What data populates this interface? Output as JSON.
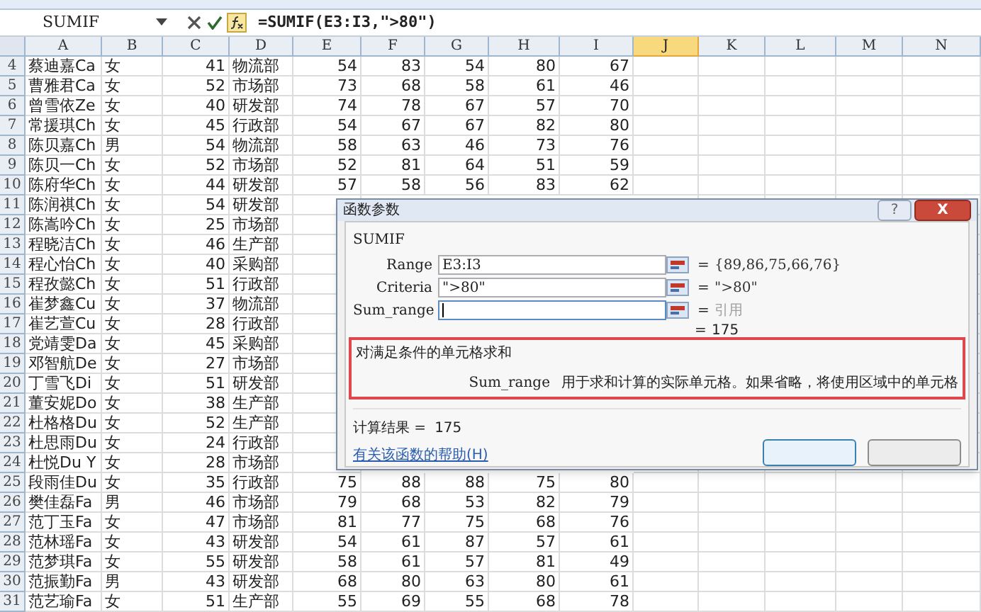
{
  "formula_bar": {
    "name_box": "SUMIF",
    "formula": "=SUMIF(E3:I3,\">80\")"
  },
  "columns": [
    {
      "label": "A",
      "selected": false
    },
    {
      "label": "B",
      "selected": false
    },
    {
      "label": "C",
      "selected": false
    },
    {
      "label": "D",
      "selected": false
    },
    {
      "label": "E",
      "selected": false
    },
    {
      "label": "F",
      "selected": false
    },
    {
      "label": "G",
      "selected": false
    },
    {
      "label": "H",
      "selected": false
    },
    {
      "label": "I",
      "selected": false
    },
    {
      "label": "J",
      "selected": true
    },
    {
      "label": "K",
      "selected": false
    },
    {
      "label": "L",
      "selected": false
    },
    {
      "label": "M",
      "selected": false
    },
    {
      "label": "N",
      "selected": false
    }
  ],
  "rows": [
    {
      "row": "4",
      "cells": [
        "蔡迪嘉Ca",
        "女",
        "41",
        "物流部",
        "54",
        "83",
        "54",
        "80",
        "67"
      ]
    },
    {
      "row": "5",
      "cells": [
        "曹雅君Ca",
        "女",
        "52",
        "市场部",
        "73",
        "68",
        "58",
        "61",
        "46"
      ]
    },
    {
      "row": "6",
      "cells": [
        "曾雪依Ze",
        "女",
        "40",
        "研发部",
        "74",
        "78",
        "67",
        "57",
        "70"
      ]
    },
    {
      "row": "7",
      "cells": [
        "常援琪Ch",
        "女",
        "45",
        "行政部",
        "54",
        "67",
        "67",
        "82",
        "80"
      ]
    },
    {
      "row": "8",
      "cells": [
        "陈贝嘉Ch",
        "男",
        "54",
        "物流部",
        "58",
        "63",
        "46",
        "73",
        "76"
      ]
    },
    {
      "row": "9",
      "cells": [
        "陈贝一Ch",
        "女",
        "52",
        "市场部",
        "52",
        "81",
        "64",
        "51",
        "59"
      ]
    },
    {
      "row": "10",
      "cells": [
        "陈府华Ch",
        "女",
        "44",
        "研发部",
        "57",
        "58",
        "56",
        "83",
        "62"
      ]
    },
    {
      "row": "11",
      "cells": [
        "陈润祺Ch",
        "女",
        "54",
        "研发部"
      ]
    },
    {
      "row": "12",
      "cells": [
        "陈嵩吟Ch",
        "女",
        "25",
        "市场部"
      ]
    },
    {
      "row": "13",
      "cells": [
        "程晓洁Ch",
        "女",
        "46",
        "生产部"
      ]
    },
    {
      "row": "14",
      "cells": [
        "程心怡Ch",
        "女",
        "40",
        "采购部"
      ]
    },
    {
      "row": "15",
      "cells": [
        "程孜懿Ch",
        "女",
        "51",
        "行政部"
      ]
    },
    {
      "row": "16",
      "cells": [
        "崔梦鑫Cu",
        "女",
        "37",
        "物流部"
      ]
    },
    {
      "row": "17",
      "cells": [
        "崔艺萱Cu",
        "女",
        "28",
        "行政部"
      ]
    },
    {
      "row": "18",
      "cells": [
        "党靖雯Da",
        "女",
        "45",
        "采购部"
      ]
    },
    {
      "row": "19",
      "cells": [
        "邓智航De",
        "女",
        "27",
        "市场部"
      ]
    },
    {
      "row": "20",
      "cells": [
        "丁雪飞Di",
        "女",
        "51",
        "研发部"
      ]
    },
    {
      "row": "21",
      "cells": [
        "董安妮Do",
        "女",
        "38",
        "生产部"
      ]
    },
    {
      "row": "22",
      "cells": [
        "杜格格Du",
        "女",
        "52",
        "生产部"
      ]
    },
    {
      "row": "23",
      "cells": [
        "杜思雨Du",
        "女",
        "24",
        "行政部"
      ]
    },
    {
      "row": "24",
      "cells": [
        "杜悦Du Y",
        "女",
        "28",
        "市场部"
      ]
    },
    {
      "row": "25",
      "cells": [
        "段雨佳Du",
        "女",
        "35",
        "行政部",
        "75",
        "88",
        "88",
        "75",
        "80"
      ]
    },
    {
      "row": "26",
      "cells": [
        "樊佳磊Fa",
        "男",
        "46",
        "市场部",
        "79",
        "68",
        "53",
        "82",
        "79"
      ]
    },
    {
      "row": "27",
      "cells": [
        "范丁玉Fa",
        "女",
        "47",
        "市场部",
        "81",
        "77",
        "75",
        "68",
        "76"
      ]
    },
    {
      "row": "28",
      "cells": [
        "范林瑶Fa",
        "女",
        "43",
        "研发部",
        "54",
        "61",
        "87",
        "57",
        "61"
      ]
    },
    {
      "row": "29",
      "cells": [
        "范梦琪Fa",
        "女",
        "55",
        "研发部",
        "58",
        "61",
        "57",
        "81",
        "49"
      ]
    },
    {
      "row": "30",
      "cells": [
        "范振勤Fa",
        "男",
        "43",
        "研发部",
        "68",
        "80",
        "63",
        "80",
        "61"
      ]
    },
    {
      "row": "31",
      "cells": [
        "范艺瑜Fa",
        "女",
        "51",
        "生产部",
        "55",
        "69",
        "55",
        "68",
        "78"
      ]
    }
  ],
  "dialog": {
    "title": "函数参数",
    "help": "?",
    "close": "X",
    "function": "SUMIF",
    "arguments": [
      {
        "label": "Range",
        "value": "E3:I3",
        "result": "{89,86,75,66,76}",
        "muted": false,
        "focused": false
      },
      {
        "label": "Criteria",
        "value": "\">80\"",
        "result": "\">80\"",
        "muted": false,
        "focused": false
      },
      {
        "label": "Sum_range",
        "result": "引用",
        "muted": true,
        "focused": true
      }
    ],
    "equals": "=",
    "total": "175",
    "description": "对满足条件的单元格求和",
    "argument_help_name": "Sum_range",
    "argument_help": "用于求和计算的实际单元格。如果省略，将使用区域中的单元格",
    "result_label": "计算结果 =",
    "result_value": "175",
    "help_link": "有关该函数的帮助(H)"
  }
}
